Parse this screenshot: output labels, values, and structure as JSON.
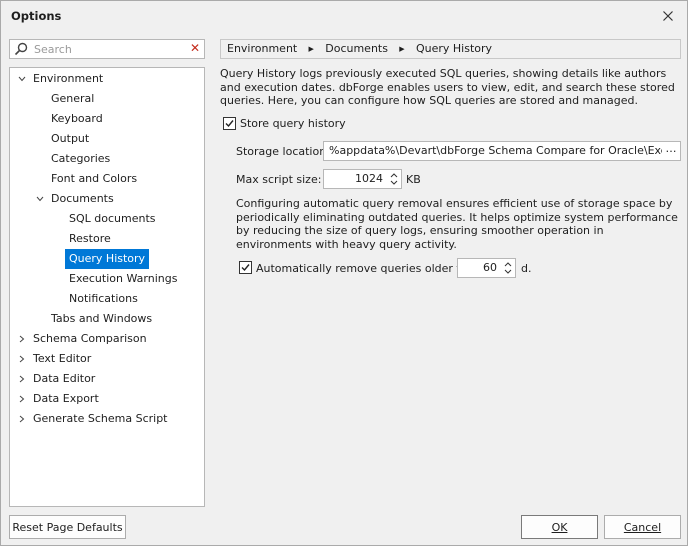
{
  "window": {
    "title": "Options"
  },
  "search": {
    "placeholder": "Search"
  },
  "tree": {
    "items": [
      {
        "label": "Environment",
        "level": 0,
        "expanded": true
      },
      {
        "label": "General",
        "level": 1
      },
      {
        "label": "Keyboard",
        "level": 1
      },
      {
        "label": "Output",
        "level": 1
      },
      {
        "label": "Categories",
        "level": 1
      },
      {
        "label": "Font and Colors",
        "level": 1
      },
      {
        "label": "Documents",
        "level": 1,
        "expanded": true
      },
      {
        "label": "SQL documents",
        "level": 2
      },
      {
        "label": "Restore",
        "level": 2
      },
      {
        "label": "Query History",
        "level": 2,
        "selected": true
      },
      {
        "label": "Execution Warnings",
        "level": 2
      },
      {
        "label": "Notifications",
        "level": 2
      },
      {
        "label": "Tabs and Windows",
        "level": 1
      },
      {
        "label": "Schema Comparison",
        "level": 0,
        "expanded": false
      },
      {
        "label": "Text Editor",
        "level": 0,
        "expanded": false
      },
      {
        "label": "Data Editor",
        "level": 0,
        "expanded": false
      },
      {
        "label": "Data Export",
        "level": 0,
        "expanded": false
      },
      {
        "label": "Generate Schema Script",
        "level": 0,
        "expanded": false
      }
    ]
  },
  "breadcrumb": [
    "Environment",
    "Documents",
    "Query History"
  ],
  "page": {
    "description": "Query History logs previously executed SQL queries, showing details like authors and execution dates. dbForge enables users to view, edit, and search these stored queries. Here, you can configure how SQL queries are stored and managed.",
    "store_history": {
      "label": "Store query history",
      "checked": true
    },
    "storage_location": {
      "label": "Storage location:",
      "value": "%appdata%\\Devart\\dbForge Schema Compare for Oracle\\ExecutedQueries"
    },
    "max_script_size": {
      "label": "Max script size:",
      "value": "1024",
      "unit": "KB"
    },
    "cleanup_description": "Configuring automatic query removal ensures efficient use of storage space by periodically eliminating outdated queries. It helps optimize system performance by reducing the size of query logs, ensuring smoother operation in environments with heavy query activity.",
    "auto_remove": {
      "label": "Automatically remove queries older than:",
      "checked": true,
      "value": "60",
      "unit": "d."
    }
  },
  "buttons": {
    "reset": "Reset Page Defaults",
    "ok": "OK",
    "cancel": "Cancel"
  }
}
